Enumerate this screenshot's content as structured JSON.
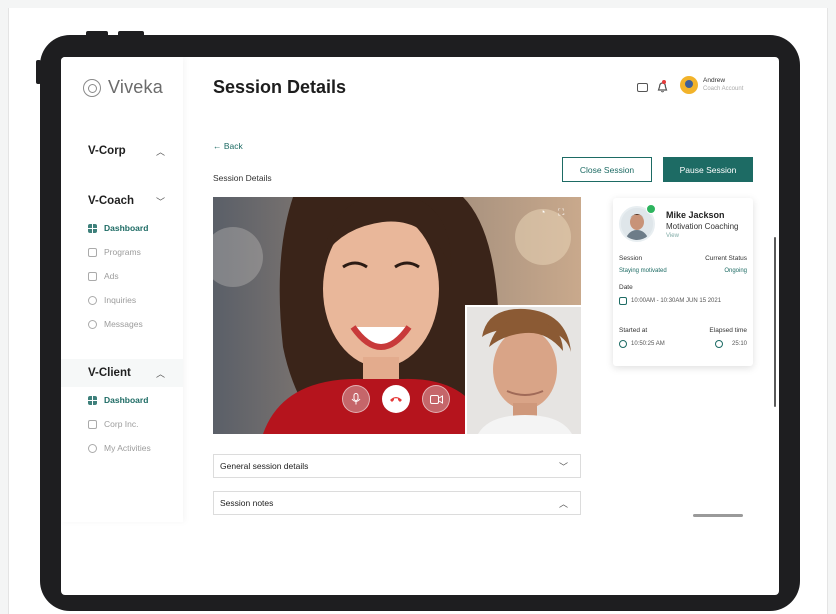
{
  "app": {
    "logo_text": "Viveka"
  },
  "header": {
    "title": "Session Details",
    "user_name": "Andrew",
    "user_role": "Coach Account"
  },
  "sidebar": {
    "groups": [
      {
        "label": "V-Corp",
        "chevron": "up",
        "items": []
      },
      {
        "label": "V-Coach",
        "chevron": "down",
        "items": [
          {
            "label": "Dashboard",
            "icon": "grid-icon",
            "active": true
          },
          {
            "label": "Programs",
            "icon": "document-icon",
            "active": false
          },
          {
            "label": "Ads",
            "icon": "ad-icon",
            "active": false
          },
          {
            "label": "Inquiries",
            "icon": "chat-icon",
            "active": false
          },
          {
            "label": "Messages",
            "icon": "message-icon",
            "active": false
          }
        ]
      },
      {
        "label": "V-Client",
        "chevron": "up",
        "items": [
          {
            "label": "Dashboard",
            "icon": "grid-icon",
            "active": true
          },
          {
            "label": "Corp Inc.",
            "icon": "building-icon",
            "active": false
          },
          {
            "label": "My Activities",
            "icon": "activity-icon",
            "active": false
          }
        ]
      }
    ]
  },
  "content": {
    "back_label": "← Back",
    "section_label": "Session Details",
    "close_session_label": "Close Session",
    "pause_session_label": "Pause Session",
    "accordions": [
      {
        "label": "General session details",
        "state": "collapsed"
      },
      {
        "label": "Session notes",
        "state": "expanded"
      }
    ]
  },
  "session_card": {
    "name": "Mike Jackson",
    "program": "Motivation Coaching",
    "view_link": "View",
    "session_label": "Session",
    "session_value": "Staying motivated",
    "status_label": "Current Status",
    "status_value": "Ongoing",
    "date_label": "Date",
    "date_value": "10:00AM - 10:30AM JUN 15 2021",
    "started_label": "Started at",
    "started_value": "10:50:25 AM",
    "elapsed_label": "Elapsed time",
    "elapsed_value": "25:10"
  },
  "colors": {
    "accent": "#1d6b64",
    "end_call": "#e53a3a",
    "online": "#2db45e"
  }
}
